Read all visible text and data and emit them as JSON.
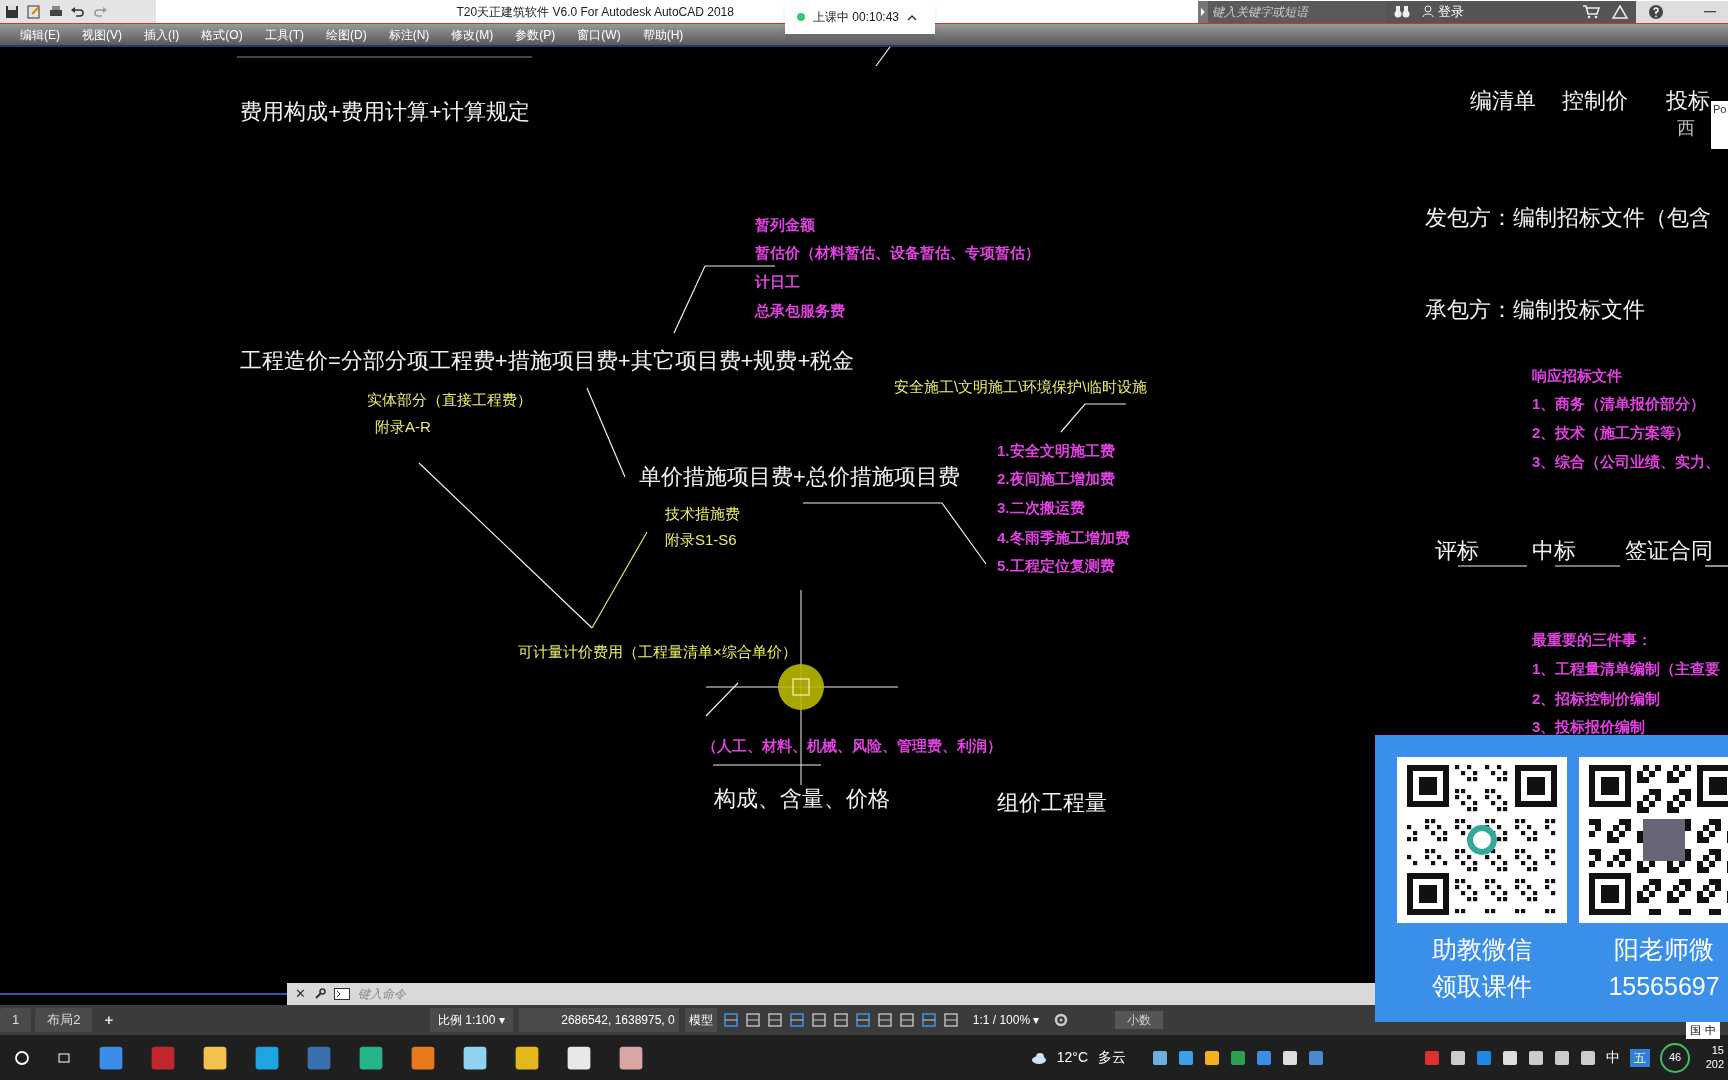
{
  "window": {
    "title": "T20天正建筑软件 V6.0 For Autodesk AutoCAD 2018",
    "search": {
      "placeholder": "键入关键字或短语"
    },
    "sign_in": "登录"
  },
  "class_timer": "上课中 00:10:43",
  "menu": [
    "编辑(E)",
    "视图(V)",
    "插入(I)",
    "格式(O)",
    "工具(T)",
    "绘图(D)",
    "标注(N)",
    "修改(M)",
    "参数(P)",
    "窗口(W)",
    "帮助(H)"
  ],
  "drawing": {
    "texts": [
      {
        "kind": "main",
        "text": "费用构成+费用计算+计算规定"
      },
      {
        "kind": "list",
        "text": "暂列金额"
      },
      {
        "kind": "list",
        "text": "暂估价（材料暂估、设备暂估、专项暂估）"
      },
      {
        "kind": "list",
        "text": "计日工"
      },
      {
        "kind": "list",
        "text": "总承包服务费"
      },
      {
        "kind": "main",
        "text": "工程造价=分部分项工程费+措施项目费+其它项目费+规费+税金"
      },
      {
        "kind": "note",
        "text": "实体部分（直接工程费）"
      },
      {
        "kind": "note",
        "text": "附录A-R"
      },
      {
        "kind": "note",
        "text": "安全施工\\文明施工\\环境保护\\临时设施"
      },
      {
        "kind": "main",
        "text": "单价措施项目费+总价措施项目费"
      },
      {
        "kind": "note",
        "text": "技术措施费"
      },
      {
        "kind": "note",
        "text": "附录S1-S6"
      },
      {
        "kind": "list",
        "text": "1.安全文明施工费"
      },
      {
        "kind": "list",
        "text": "2.夜间施工增加费"
      },
      {
        "kind": "list",
        "text": "3.二次搬运费"
      },
      {
        "kind": "list",
        "text": "4.冬雨季施工增加费"
      },
      {
        "kind": "list",
        "text": "5.工程定位复测费"
      },
      {
        "kind": "note",
        "text": "可计量计价费用（工程量清单×综合单价）"
      },
      {
        "kind": "list",
        "text": "（人工、材料、机械、风险、管理费、利润）"
      },
      {
        "kind": "main",
        "text": "构成、含量、价格"
      },
      {
        "kind": "main",
        "text": "组价工程量"
      },
      {
        "kind": "main",
        "text": "编清单"
      },
      {
        "kind": "main",
        "text": "控制价"
      },
      {
        "kind": "main",
        "text": "投标"
      },
      {
        "kind": "dim",
        "text": "西"
      },
      {
        "kind": "main",
        "text": "发包方：编制招标文件（包含"
      },
      {
        "kind": "main",
        "text": "承包方：编制投标文件"
      },
      {
        "kind": "list",
        "text": "响应招标文件"
      },
      {
        "kind": "list",
        "text": "1、商务（清单报价部分）"
      },
      {
        "kind": "list",
        "text": "2、技术（施工方案等）"
      },
      {
        "kind": "list",
        "text": "3、综合（公司业绩、实力、"
      },
      {
        "kind": "main",
        "text": "评标"
      },
      {
        "kind": "main",
        "text": "中标"
      },
      {
        "kind": "main",
        "text": "签证合同"
      },
      {
        "kind": "list",
        "text": "最重要的三件事："
      },
      {
        "kind": "list",
        "text": "1、工程量清单编制（主查要"
      },
      {
        "kind": "list",
        "text": "2、招标控制价编制"
      },
      {
        "kind": "list",
        "text": "3、投标报价编制"
      }
    ],
    "popup_fragment": "Po"
  },
  "command_line": {
    "close": "✕",
    "placeholder": "键入命令"
  },
  "dropdown_arrows": [
    "▾",
    "▾"
  ],
  "layout_tabs": [
    "1",
    "布局2"
  ],
  "add_tab": "+",
  "status_bar": {
    "scale": "比例 1:100",
    "coordinates": "2686542, 1638975, 0",
    "space": "模型",
    "annotation_scale": "1:1 / 100%",
    "units": "小数"
  },
  "qr_panel": {
    "cards": [
      {
        "caption": "助教微信",
        "subcaption": "领取课件"
      },
      {
        "caption": "阳老师微",
        "subcaption": "15565697"
      }
    ]
  },
  "taskbar": {
    "temperature": "12°C",
    "weather": "多云",
    "ime": "中",
    "ime_mode": "五",
    "badge": "46",
    "clock_time": "15",
    "clock_date": "202"
  },
  "ime_bar": [
    "国",
    "中"
  ]
}
